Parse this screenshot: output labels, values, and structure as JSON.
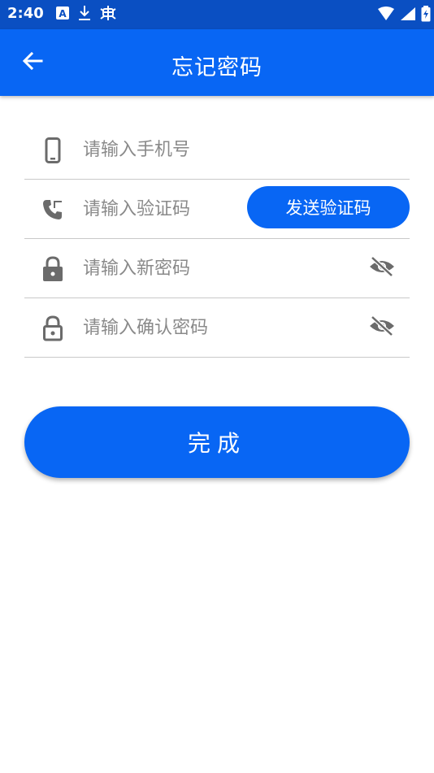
{
  "status_bar": {
    "time": "2:40",
    "icons": [
      "keyboard-a-icon",
      "download-icon",
      "bug-icon",
      "wifi-icon",
      "signal-icon",
      "battery-icon"
    ]
  },
  "app_bar": {
    "title": "忘记密码",
    "back_icon": "arrow-left-icon"
  },
  "form": {
    "phone": {
      "placeholder": "请输入手机号",
      "value": "",
      "icon": "phone-icon"
    },
    "code": {
      "placeholder": "请输入验证码",
      "value": "",
      "icon": "phone-call-icon",
      "send_button": "发送验证码"
    },
    "new_password": {
      "placeholder": "请输入新密码",
      "value": "",
      "icon": "lock-filled-icon",
      "visibility_icon": "eye-off-icon"
    },
    "confirm_password": {
      "placeholder": "请输入确认密码",
      "value": "",
      "icon": "lock-outline-icon",
      "visibility_icon": "eye-off-icon"
    }
  },
  "submit_button": "完成",
  "colors": {
    "status_bar": "#0a4fc2",
    "primary": "#0866f4",
    "icon_gray": "#6b6b6b",
    "divider": "#c9c9c9",
    "placeholder": "#8a8a8a"
  }
}
